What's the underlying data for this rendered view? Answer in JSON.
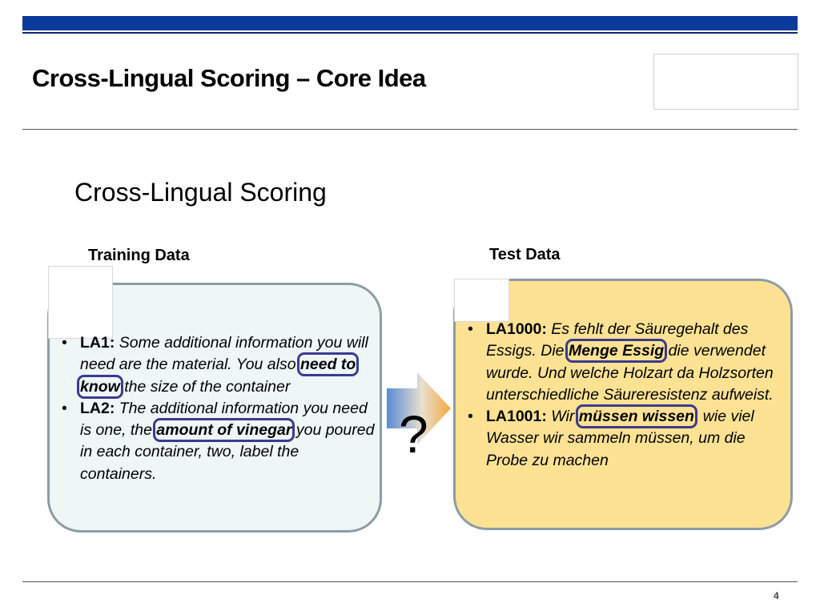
{
  "slide": {
    "title": "Cross-Lingual Scoring – Core Idea",
    "subtitle": "Cross-Lingual Scoring",
    "page_number": "4"
  },
  "training": {
    "heading": "Training Data",
    "items": [
      {
        "label": "LA1:",
        "text_before": "Some additional information you will need are the material. You also ",
        "highlight": "need to know",
        "text_after": " the size of the container"
      },
      {
        "label": "LA2:",
        "text_before": "The additional information you need is one, the ",
        "highlight": "amount of vinegar",
        "text_after": " you poured in each container, two, label the containers."
      }
    ]
  },
  "test": {
    "heading": "Test Data",
    "items": [
      {
        "label": "LA1000:",
        "text_before": "Es  fehlt  der Säuregehalt des Essigs. Die ",
        "highlight": "Menge Essig",
        "text_after": " die verwendet wurde. Und welche Holzart da Holzsorten unterschiedliche Säureresistenz aufweist."
      },
      {
        "label": "LA1001:",
        "text_before": "Wir ",
        "highlight": "müssen wissen",
        "text_after": ", wie viel Wasser wir sammeln müssen, um die Probe zu machen"
      }
    ]
  },
  "transfer": {
    "question_mark": "?"
  },
  "colors": {
    "header_bar": "#0a3a9a",
    "training_panel": "#eef7f6",
    "test_panel": "#fde294",
    "panel_border": "#8d9ca4",
    "highlight_outline": "#3b3a8f"
  }
}
